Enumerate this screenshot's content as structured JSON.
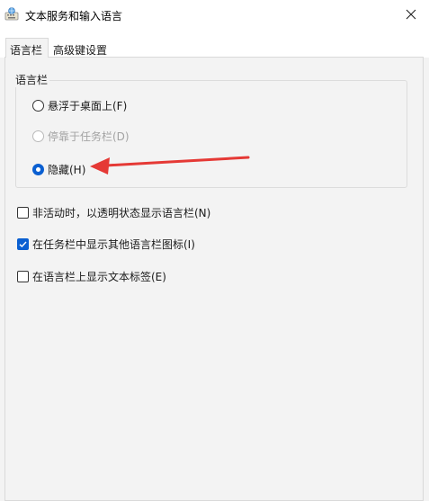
{
  "window": {
    "title": "文本服务和输入语言",
    "icon": "keyboard-globe-icon",
    "close_icon": "close-icon"
  },
  "tabs": [
    {
      "label": "语言栏",
      "active": true
    },
    {
      "label": "高级键设置",
      "active": false
    }
  ],
  "language_bar_group": {
    "legend": "语言栏",
    "options": [
      {
        "label": "悬浮于桌面上(F)",
        "checked": false,
        "disabled": false
      },
      {
        "label": "停靠于任务栏(D)",
        "checked": false,
        "disabled": true
      },
      {
        "label": "隐藏(H)",
        "checked": true,
        "disabled": false
      }
    ]
  },
  "checkboxes": [
    {
      "label": "非活动时，以透明状态显示语言栏(N)",
      "checked": false
    },
    {
      "label": "在任务栏中显示其他语言栏图标(I)",
      "checked": true
    },
    {
      "label": "在语言栏上显示文本标签(E)",
      "checked": false
    }
  ],
  "colors": {
    "accent": "#0a5fd1",
    "annotation_arrow": "#e53935"
  }
}
